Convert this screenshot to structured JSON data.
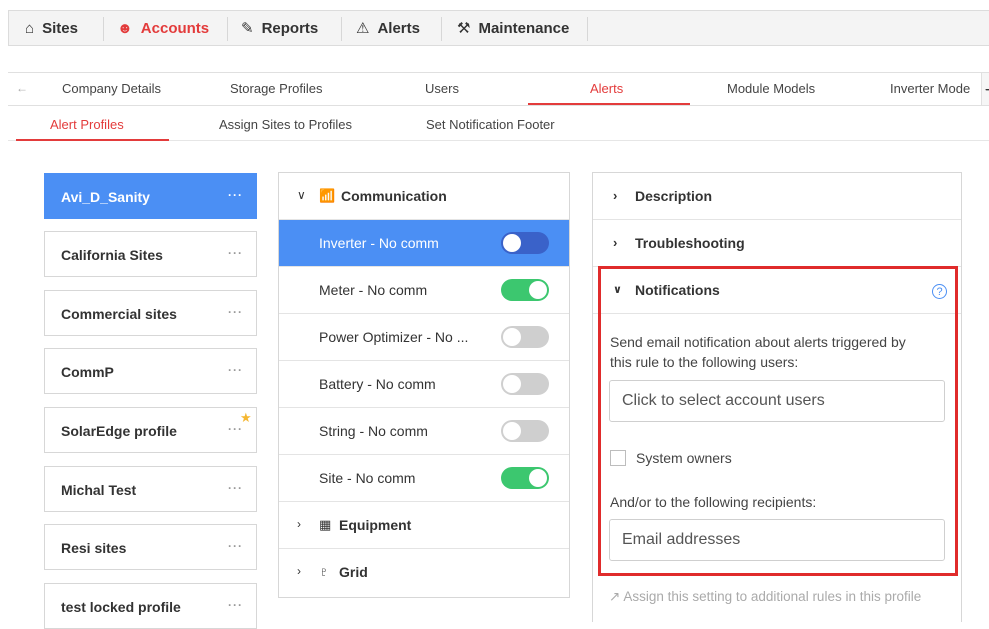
{
  "topnav": {
    "items": [
      {
        "label": "Sites",
        "icon": "home-icon",
        "glyph": "⌂"
      },
      {
        "label": "Accounts",
        "icon": "users-icon",
        "glyph": "☻"
      },
      {
        "label": "Reports",
        "icon": "report-edit-icon",
        "glyph": "✎"
      },
      {
        "label": "Alerts",
        "icon": "warning-icon",
        "glyph": "⚠"
      },
      {
        "label": "Maintenance",
        "icon": "tools-icon",
        "glyph": "⚒"
      }
    ],
    "active": "Accounts"
  },
  "tabs": {
    "items": [
      "Company Details",
      "Storage Profiles",
      "Users",
      "Alerts",
      "Module Models",
      "Inverter Mode"
    ],
    "active": "Alerts"
  },
  "subtabs": {
    "items": [
      "Alert Profiles",
      "Assign Sites to Profiles",
      "Set Notification Footer"
    ],
    "active": "Alert Profiles"
  },
  "profiles": [
    {
      "name": "Avi_D_Sanity",
      "selected": true
    },
    {
      "name": "California Sites"
    },
    {
      "name": "Commercial sites"
    },
    {
      "name": "CommP"
    },
    {
      "name": "SolarEdge profile",
      "starred": true
    },
    {
      "name": "Michal Test"
    },
    {
      "name": "Resi sites"
    },
    {
      "name": "test locked profile"
    }
  ],
  "profile_menu_glyph": "···",
  "categories": {
    "communication": {
      "label": "Communication",
      "icon": "wifi-icon",
      "rules": [
        {
          "label": "Inverter - No comm",
          "on": false,
          "selected": true
        },
        {
          "label": "Meter - No comm",
          "on": true
        },
        {
          "label": "Power Optimizer - No ...",
          "on": false
        },
        {
          "label": "Battery - No comm",
          "on": false
        },
        {
          "label": "String - No comm",
          "on": false
        },
        {
          "label": "Site - No comm",
          "on": true
        }
      ]
    },
    "equipment": {
      "label": "Equipment",
      "icon": "equipment-icon"
    },
    "grid": {
      "label": "Grid",
      "icon": "grid-tower-icon"
    }
  },
  "details": {
    "description": "Description",
    "troubleshooting": "Troubleshooting",
    "notifications": {
      "title": "Notifications",
      "help": "?",
      "intro_line1": "Send email notification about alerts triggered by",
      "intro_line2": "this rule to the following users:",
      "users_placeholder": "Click to select account users",
      "system_owners": "System owners",
      "recipients_label": "And/or to the following recipients:",
      "email_placeholder": "Email addresses"
    },
    "assign_link": "Assign this setting to additional rules in this profile"
  },
  "colors": {
    "accent": "#e33b3b",
    "selected": "#4b8ff4",
    "toggle_on": "#3cc76f",
    "toggle_off": "#cfcfcf"
  }
}
